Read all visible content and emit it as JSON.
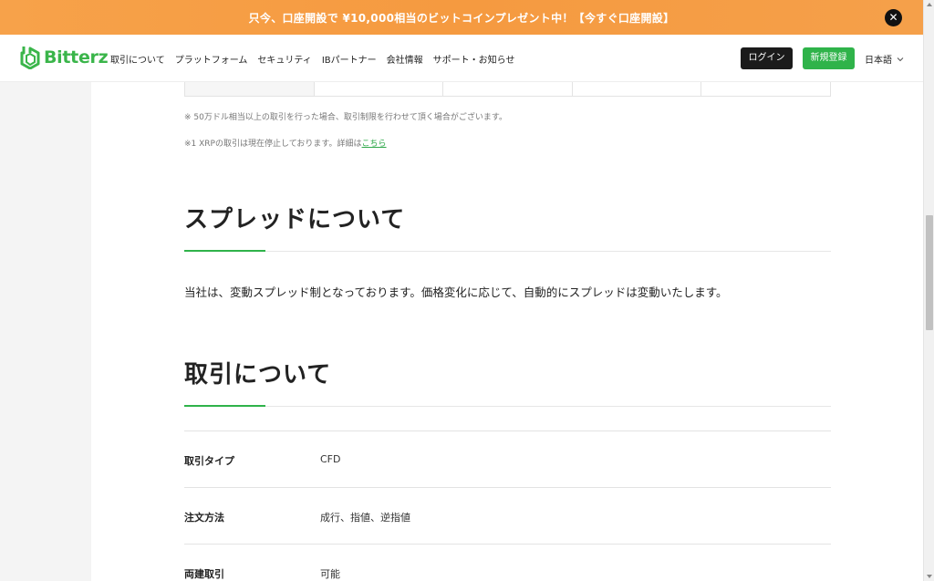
{
  "promo": {
    "text": "只今、口座開設で ¥10,000相当のビットコインプレゼント中！【今すぐ口座開設】",
    "close_icon": "close-icon",
    "color": "#f59e45"
  },
  "header": {
    "logo_text": "Bitterz",
    "brand_color": "#3ab54a",
    "nav": [
      "取引について",
      "プラットフォーム",
      "セキュリティ",
      "IBパートナー",
      "会社情報",
      "サポート・お知らせ"
    ],
    "login_label": "ログイン",
    "signup_label": "新規登録",
    "language_label": "日本語"
  },
  "notes": {
    "note1": "※ 50万ドル相当以上の取引を行った場合、取引制限を行わせて頂く場合がございます。",
    "note2_prefix": "※1  XRPの取引は現在停止しております。詳細は",
    "note2_link": "こちら"
  },
  "spread": {
    "heading": "スプレッドについて",
    "body": "当社は、変動スプレッド制となっております。価格変化に応じて、自動的にスプレッドは変動いたします。"
  },
  "trading": {
    "heading": "取引について",
    "rows": [
      {
        "label": "取引タイプ",
        "value": "CFD"
      },
      {
        "label": "注文方法",
        "value": "成行、指値、逆指値"
      },
      {
        "label": "両建取引",
        "value": "可能"
      }
    ]
  }
}
